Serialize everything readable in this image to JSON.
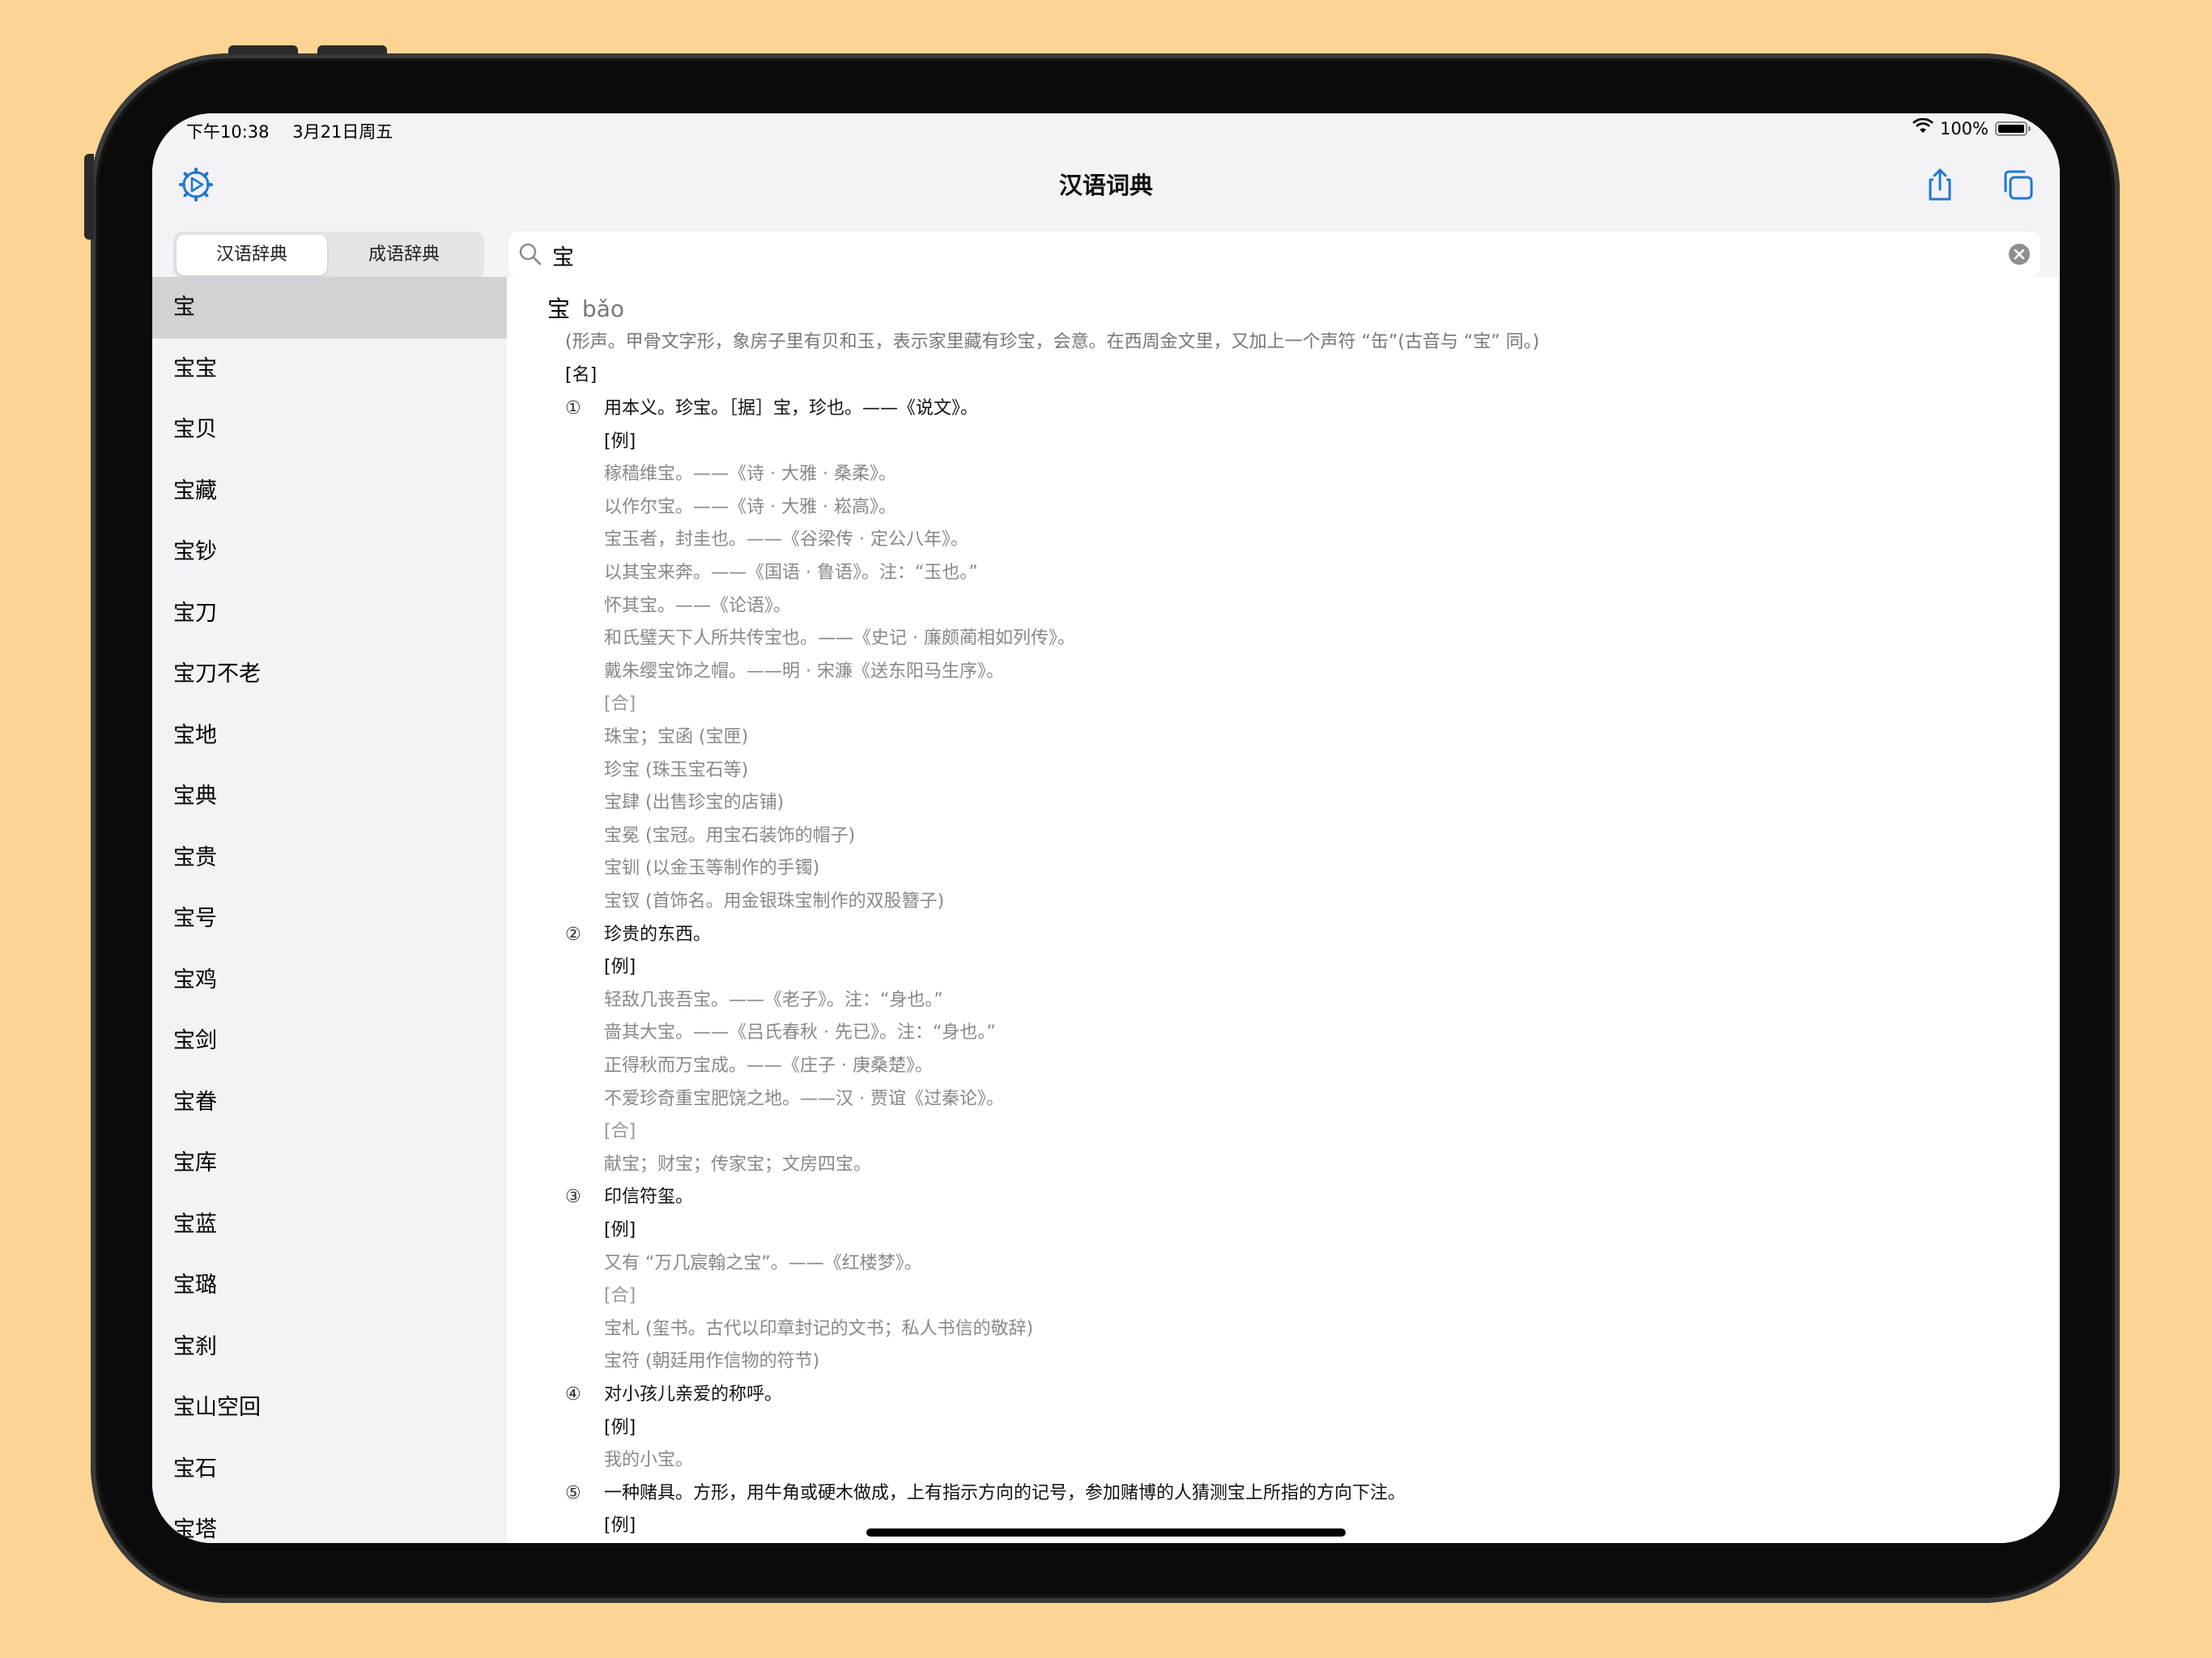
{
  "status": {
    "time": "下午10:38",
    "date": "3月21日周五",
    "battery": "100%"
  },
  "nav": {
    "title": "汉语词典"
  },
  "tabs": {
    "han": "汉语辞典",
    "idiom": "成语辞典"
  },
  "search": {
    "query": "宝"
  },
  "list": [
    "宝",
    "宝宝",
    "宝贝",
    "宝藏",
    "宝钞",
    "宝刀",
    "宝刀不老",
    "宝地",
    "宝典",
    "宝贵",
    "宝号",
    "宝鸡",
    "宝剑",
    "宝眷",
    "宝库",
    "宝蓝",
    "宝璐",
    "宝刹",
    "宝山空回",
    "宝石",
    "宝塔"
  ],
  "entry": {
    "char": "宝",
    "pinyin": "bǎo",
    "etymology": "(形声。甲骨文字形，象房子里有贝和玉，表示家里藏有珍宝，会意。在西周金文里，又加上一个声符 “缶”(古音与 “宝” 同。)",
    "pos": "[名]",
    "lines": [
      {
        "kind": "num",
        "num": "①",
        "text": "用本义。珍宝。［据］宝，珍也。——《说文》。"
      },
      {
        "kind": "lab",
        "text": "[例]"
      },
      {
        "kind": "ex",
        "text": "稼穑维宝。——《诗 · 大雅 · 桑柔》。"
      },
      {
        "kind": "ex",
        "text": "以作尔宝。——《诗 · 大雅 · 崧高》。"
      },
      {
        "kind": "ex",
        "text": "宝玉者，封圭也。——《谷梁传 · 定公八年》。"
      },
      {
        "kind": "ex",
        "text": "以其宝来奔。——《国语 · 鲁语》。注：“玉也。”"
      },
      {
        "kind": "ex",
        "text": "怀其宝。——《论语》。"
      },
      {
        "kind": "ex",
        "text": "和氏璧天下人所共传宝也。——《史记 · 廉颇蔺相如列传》。"
      },
      {
        "kind": "ex",
        "text": "戴朱缨宝饰之帽。——明 · 宋濂《送东阳马生序》。"
      },
      {
        "kind": "glab",
        "text": "[合]"
      },
      {
        "kind": "ex",
        "text": "珠宝；宝函 (宝匣)"
      },
      {
        "kind": "ex",
        "text": "珍宝 (珠玉宝石等)"
      },
      {
        "kind": "ex",
        "text": "宝肆 (出售珍宝的店铺)"
      },
      {
        "kind": "ex",
        "text": "宝冕 (宝冠。用宝石装饰的帽子)"
      },
      {
        "kind": "ex",
        "text": "宝钏 (以金玉等制作的手镯)"
      },
      {
        "kind": "ex",
        "text": "宝钗 (首饰名。用金银珠宝制作的双股簪子)"
      },
      {
        "kind": "num",
        "num": "②",
        "text": "珍贵的东西。"
      },
      {
        "kind": "lab",
        "text": "[例]"
      },
      {
        "kind": "ex",
        "text": "轻敌几丧吾宝。——《老子》。注：“身也。”"
      },
      {
        "kind": "ex",
        "text": "啬其大宝。——《吕氏春秋 · 先已》。注：“身也。”"
      },
      {
        "kind": "ex",
        "text": "正得秋而万宝成。——《庄子 · 庚桑楚》。"
      },
      {
        "kind": "ex",
        "text": "不爱珍奇重宝肥饶之地。——汉 · 贾谊《过秦论》。"
      },
      {
        "kind": "glab",
        "text": "[合]"
      },
      {
        "kind": "ex",
        "text": "献宝；财宝；传家宝；文房四宝。"
      },
      {
        "kind": "num",
        "num": "③",
        "text": "印信符玺。"
      },
      {
        "kind": "lab",
        "text": "[例]"
      },
      {
        "kind": "ex",
        "text": "又有 “万几宸翰之宝”。——《红楼梦》。"
      },
      {
        "kind": "glab",
        "text": "[合]"
      },
      {
        "kind": "ex",
        "text": "宝札 (玺书。古代以印章封记的文书；私人书信的敬辞)"
      },
      {
        "kind": "ex",
        "text": "宝符 (朝廷用作信物的符节)"
      },
      {
        "kind": "num",
        "num": "④",
        "text": "对小孩儿亲爱的称呼。"
      },
      {
        "kind": "lab",
        "text": "[例]"
      },
      {
        "kind": "ex",
        "text": "我的小宝。"
      },
      {
        "kind": "num",
        "num": "⑤",
        "text": "一种赌具。方形，用牛角或硬木做成，上有指示方向的记号，参加赌博的人猜测宝上所指的方向下注。"
      },
      {
        "kind": "lab",
        "text": "[例]"
      }
    ]
  },
  "colors": {
    "background": "#FCD594",
    "accent": "#1F78D1",
    "sidebar": "#F2F2F7",
    "selected_row": "#D1D1D6"
  },
  "icons": [
    "settings-icon",
    "share-icon",
    "copy-icon",
    "search-icon",
    "clear-icon",
    "wifi-icon",
    "battery-icon"
  ]
}
